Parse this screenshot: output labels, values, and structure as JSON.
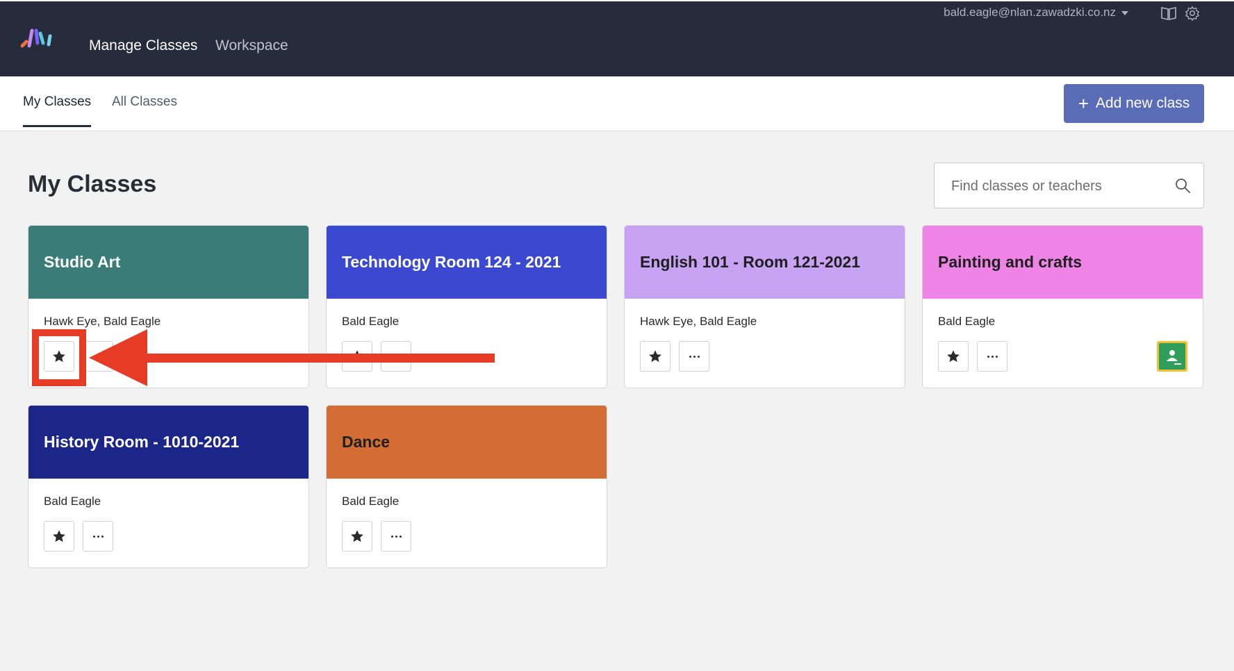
{
  "app": {
    "nav": {
      "manage_classes": "Manage Classes",
      "workspace": "Workspace"
    },
    "account_email": "bald.eagle@nlan.zawadzki.co.nz",
    "top_icons": [
      "book-icon",
      "gear-icon"
    ]
  },
  "tabs": {
    "my_classes": "My Classes",
    "all_classes": "All Classes",
    "active": "My Classes"
  },
  "add_button": {
    "icon": "+",
    "label": "Add new class"
  },
  "page_title": "My Classes",
  "search": {
    "placeholder": "Find classes or teachers"
  },
  "classes": [
    {
      "title": "Studio Art",
      "teachers": "Hawk Eye, Bald Eagle",
      "color": "#3a7d78",
      "title_color": "#ffffff",
      "starred": true
    },
    {
      "title": "Technology Room 124 - 2021",
      "teachers": "Bald Eagle",
      "color": "#3a49cf",
      "title_color": "#ffffff",
      "starred": true
    },
    {
      "title": "English 101 - Room 121-2021",
      "teachers": "Hawk Eye, Bald Eagle",
      "color": "#c8a2f3",
      "title_color": "#1f1f1f",
      "starred": true
    },
    {
      "title": "Painting and crafts",
      "teachers": "Bald Eagle",
      "color": "#ed84e6",
      "title_color": "#1f1f1f",
      "starred": true,
      "google_classroom": true
    },
    {
      "title": "History Room - 1010-2021",
      "teachers": "Bald Eagle",
      "color": "#1b2688",
      "title_color": "#ffffff",
      "starred": true
    },
    {
      "title": "Dance",
      "teachers": "Bald Eagle",
      "color": "#d36d35",
      "title_color": "#1f1f1f",
      "starred": true
    }
  ],
  "annotation": {
    "color": "#e63b25",
    "target": "star-button"
  }
}
